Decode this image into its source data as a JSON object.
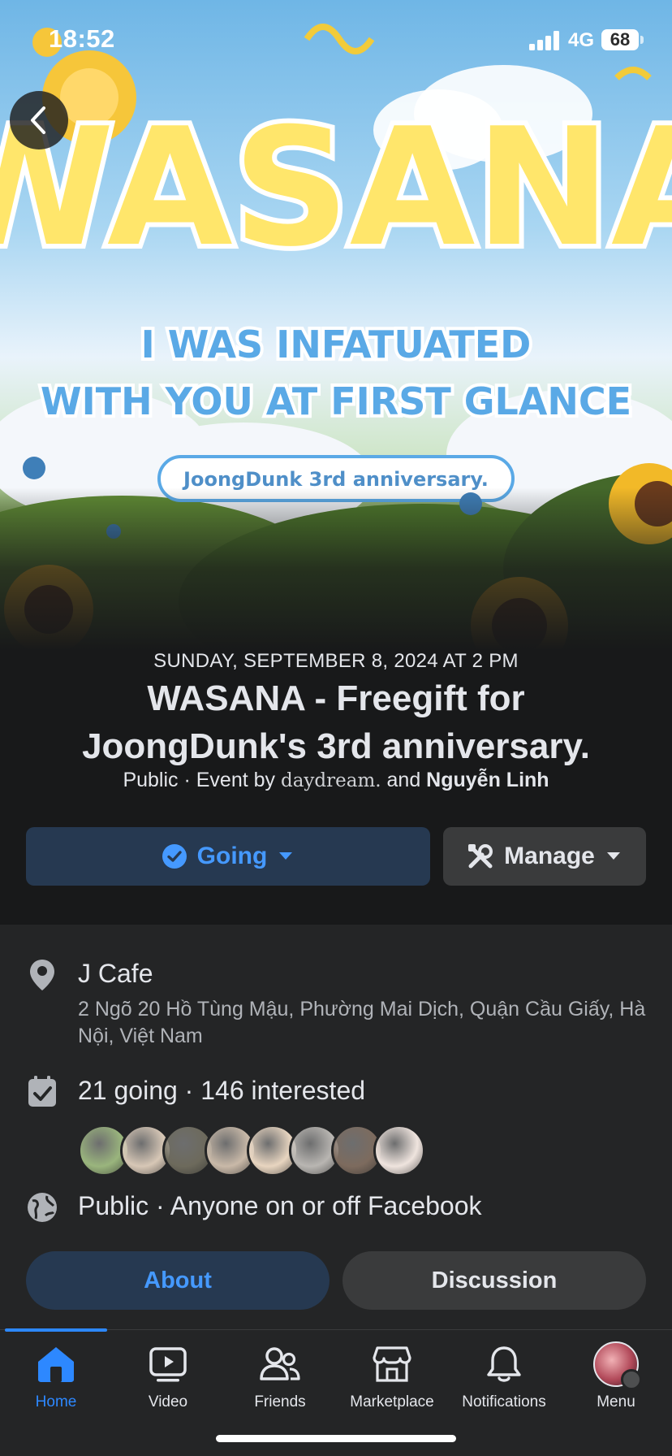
{
  "status_bar": {
    "time": "18:52",
    "network": "4G",
    "battery": "68"
  },
  "cover": {
    "headline": "WASANA",
    "tagline_line1": "I WAS INFATUATED",
    "tagline_line2": "WITH YOU AT FIRST GLANCE",
    "badge": "JoongDunk 3rd anniversary."
  },
  "event": {
    "date": "SUNDAY, SEPTEMBER 8, 2024 AT 2 PM",
    "title": "WASANA - Freegift for JoongDunk's 3rd anniversary.",
    "meta_prefix": "Public · Event by ",
    "host_1": "daydream.",
    "meta_and": " and ",
    "host_2": "Nguyễn Linh"
  },
  "actions": {
    "going_label": "Going",
    "manage_label": "Manage"
  },
  "details": {
    "location_name": "J Cafe",
    "location_address": "2 Ngõ 20 Hồ Tùng Mậu, Phường Mai Dịch, Quận Cầu Giấy, Hà Nội, Việt Nam",
    "attendance": "21 going · 146 interested",
    "privacy": "Public · Anyone on or off Facebook",
    "avatar_colors": [
      "#9ab57d",
      "#d7c7b6",
      "#6d6a5c",
      "#c9b9a8",
      "#e8d5c0",
      "#b9b6b2",
      "#7d6b5e",
      "#efe4de"
    ]
  },
  "tabs": {
    "about": "About",
    "discussion": "Discussion"
  },
  "nav": {
    "home": "Home",
    "video": "Video",
    "friends": "Friends",
    "marketplace": "Marketplace",
    "notifications": "Notifications",
    "menu": "Menu"
  },
  "colors": {
    "accent": "#2d88ff",
    "going_bg": "#263951",
    "going_text": "#4599ff",
    "surface": "#242526",
    "background": "#18191a"
  }
}
